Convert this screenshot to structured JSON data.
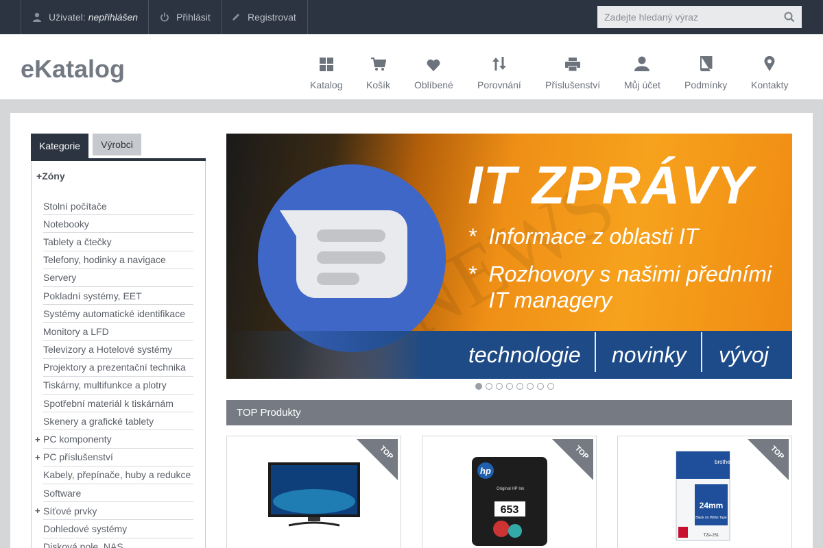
{
  "topbar": {
    "user_label": "Uživatel:",
    "user_value": "nepřihlášen",
    "login_label": "Přihlásit",
    "register_label": "Registrovat",
    "search_placeholder": "Zadejte hledaný výraz"
  },
  "header": {
    "logo": "eKatalog",
    "nav": [
      {
        "label": "Katalog",
        "icon": "grid-icon"
      },
      {
        "label": "Košík",
        "icon": "cart-icon"
      },
      {
        "label": "Oblíbené",
        "icon": "heart-icon"
      },
      {
        "label": "Porovnání",
        "icon": "sort-arrows-icon"
      },
      {
        "label": "Příslušenství",
        "icon": "printer-icon"
      },
      {
        "label": "Můj účet",
        "icon": "user-icon"
      },
      {
        "label": "Podmínky",
        "icon": "book-icon"
      },
      {
        "label": "Kontakty",
        "icon": "map-pin-icon"
      }
    ]
  },
  "sidebar": {
    "tabs": [
      "Kategorie",
      "Výrobci"
    ],
    "zone_title": "Zóny",
    "categories": [
      {
        "label": "Stolní počítače",
        "expandable": false
      },
      {
        "label": "Notebooky",
        "expandable": false
      },
      {
        "label": "Tablety a čtečky",
        "expandable": false
      },
      {
        "label": "Telefony, hodinky a navigace",
        "expandable": false
      },
      {
        "label": "Servery",
        "expandable": false
      },
      {
        "label": "Pokladní systémy, EET",
        "expandable": false
      },
      {
        "label": "Systémy automatické identifikace",
        "expandable": false
      },
      {
        "label": "Monitory a LFD",
        "expandable": false
      },
      {
        "label": "Televizory a Hotelové systémy",
        "expandable": false
      },
      {
        "label": "Projektory a prezentační technika",
        "expandable": false
      },
      {
        "label": "Tiskárny, multifunkce a plotry",
        "expandable": false
      },
      {
        "label": "Spotřební materiál k tiskárnám",
        "expandable": false
      },
      {
        "label": "Skenery a grafické tablety",
        "expandable": false
      },
      {
        "label": "PC komponenty",
        "expandable": true
      },
      {
        "label": "PC příslušenství",
        "expandable": true
      },
      {
        "label": "Kabely, přepínače, huby a redukce",
        "expandable": false
      },
      {
        "label": "Software",
        "expandable": false
      },
      {
        "label": "Síťové prvky",
        "expandable": true
      },
      {
        "label": "Dohledové systémy",
        "expandable": false
      },
      {
        "label": "Disková pole, NAS",
        "expandable": false
      }
    ]
  },
  "banner": {
    "title": "IT ZPRÁVY",
    "bullet1": "Informace z oblasti IT",
    "bullet2": "Rozhovory s našimi předními IT managery",
    "star": "*",
    "word1": "technologie",
    "word2": "novinky",
    "word3": "vývoj",
    "slides_total": 8,
    "slide_active": 1
  },
  "top_products": {
    "heading": "TOP Produkty",
    "badge": "TOP",
    "cards": [
      {
        "name": "monitor-product"
      },
      {
        "name": "hp-653-ink-product",
        "brand_text": "hp",
        "model_text": "653",
        "box_line": "Original HP Ink"
      },
      {
        "name": "brother-tape-product",
        "brand_text": "brother",
        "size_text": "24mm",
        "subtitle": "Black on White Tape",
        "code": "TZe-251"
      }
    ]
  },
  "colors": {
    "topbar_bg": "#2b3440",
    "nav_text": "#6d737c",
    "section_header": "#757a83",
    "banner_orange": "#f7a21d",
    "banner_blue": "#1d4a88"
  }
}
